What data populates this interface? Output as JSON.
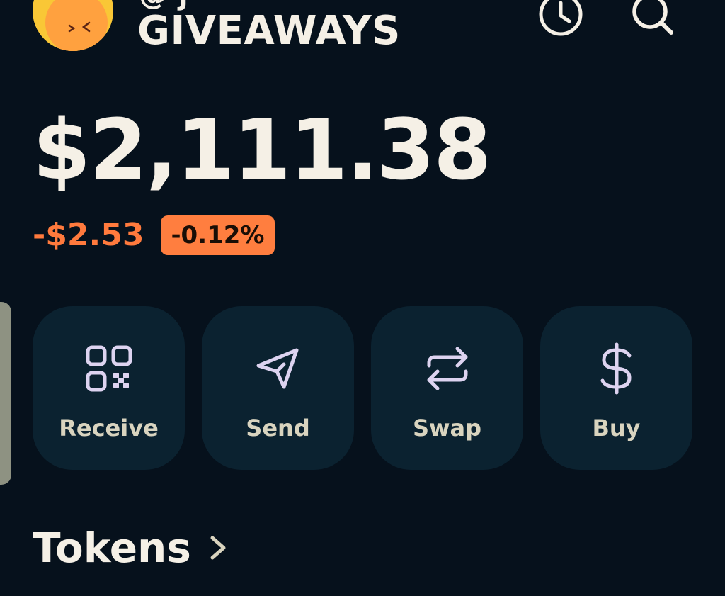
{
  "header": {
    "account_top_partial": "@ j",
    "account_name": "GIVEAWAYS",
    "history_icon": "clock-history-icon",
    "search_icon": "search-icon"
  },
  "wallet": {
    "balance": "$2,111.38",
    "change_amount": "-$2.53",
    "change_percent": "-0.12%"
  },
  "actions": [
    {
      "label": "Receive",
      "icon": "qr-code-icon"
    },
    {
      "label": "Send",
      "icon": "send-icon"
    },
    {
      "label": "Swap",
      "icon": "swap-icon"
    },
    {
      "label": "Buy",
      "icon": "dollar-icon"
    }
  ],
  "tokens": {
    "title": "Tokens"
  },
  "colors": {
    "background": "#06111c",
    "card": "#0b2230",
    "negative": "#ff7a3d",
    "icon_accent": "#ddd3f0",
    "text_primary": "#f5f0e6"
  }
}
